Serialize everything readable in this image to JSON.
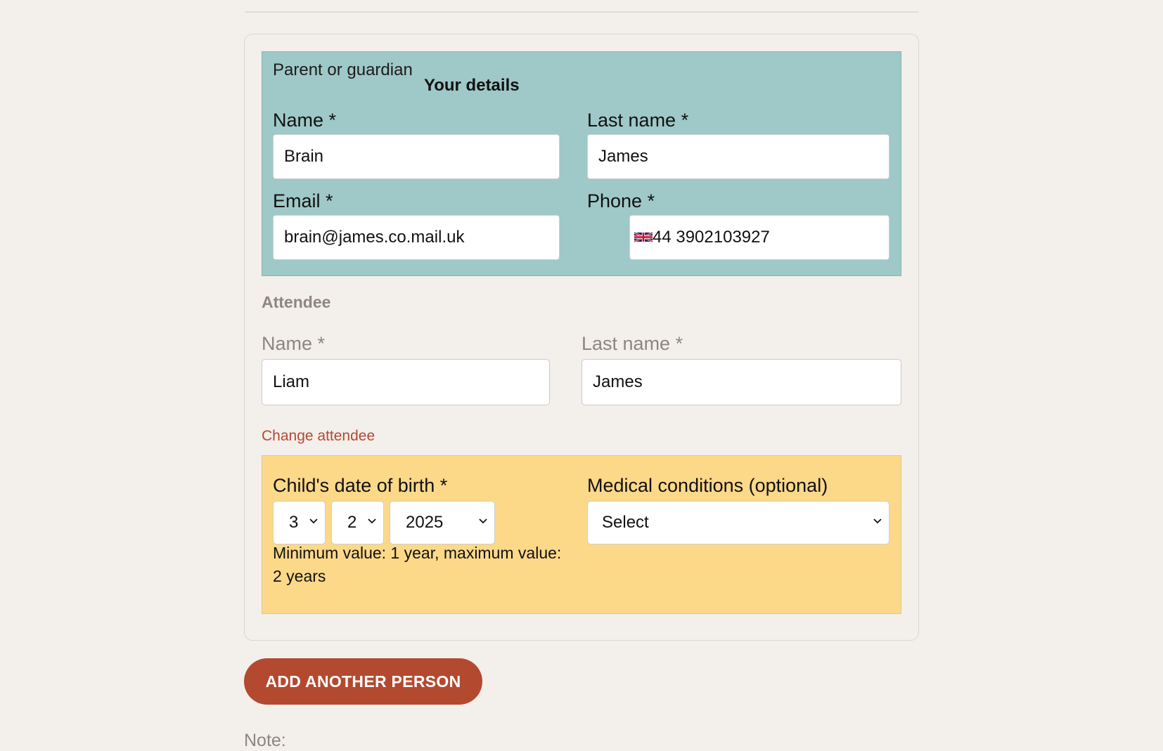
{
  "guardian": {
    "kicker": "Parent or guardian",
    "heading": "Your details",
    "name_label": "Name *",
    "name_value": "Brain",
    "last_name_label": "Last name *",
    "last_name_value": "James",
    "email_label": "Email *",
    "email_value": "brain@james.co.mail.uk",
    "phone_label": "Phone *",
    "phone_value": "44 3902103927",
    "phone_flag_icon": "uk-flag-icon"
  },
  "attendee": {
    "title": "Attendee",
    "name_label": "Name *",
    "name_value": "Liam",
    "last_name_label": "Last name *",
    "last_name_value": "James",
    "change_link": "Change attendee"
  },
  "dob": {
    "label": "Child's date of birth *",
    "day": "3",
    "month": "2",
    "year": "2025",
    "hint": "Minimum value: 1 year, maximum value: 2 years"
  },
  "medical": {
    "label": "Medical conditions (optional)",
    "selected": "Select"
  },
  "actions": {
    "add_person": "ADD ANOTHER PERSON"
  },
  "note": {
    "label": "Note:"
  },
  "colors": {
    "guardian_panel": "#9fc8c8",
    "dob_panel": "#fcd889",
    "accent": "#b3492f",
    "page_bg": "#f3efeb"
  }
}
